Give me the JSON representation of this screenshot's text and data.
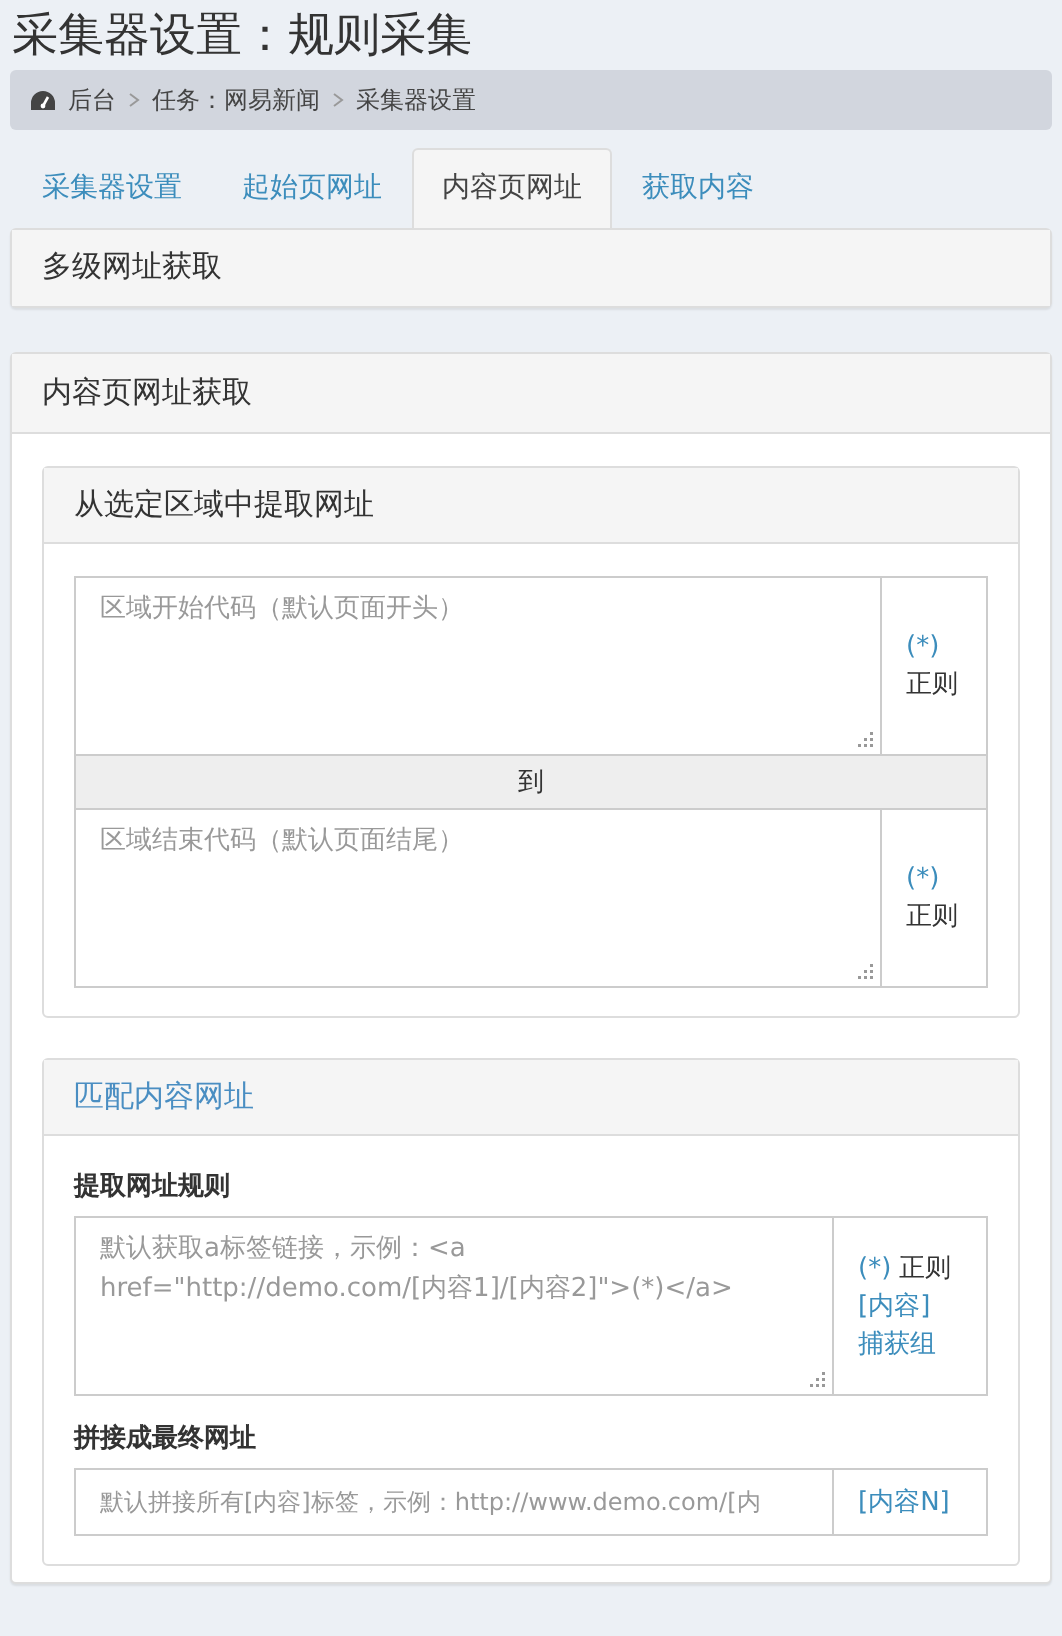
{
  "page_title": "采集器设置：规则采集",
  "breadcrumb": [
    "后台",
    "任务：网易新闻",
    "采集器设置"
  ],
  "tabs": [
    {
      "label": "采集器设置",
      "selected": false
    },
    {
      "label": "起始页网址",
      "selected": false
    },
    {
      "label": "内容页网址",
      "selected": true
    },
    {
      "label": "获取内容",
      "selected": false
    }
  ],
  "top_panel": {
    "title": "多级网址获取"
  },
  "main_panel": {
    "title": "内容页网址获取",
    "region_panel": {
      "title": "从选定区域中提取网址",
      "kind": "default",
      "start_field": {
        "placeholder": "区域开始代码（默认页面开头）",
        "addon": [
          {
            "kind": "link",
            "text": "(*)"
          },
          {
            "kind": "text",
            "text": "正则"
          }
        ]
      },
      "separator": "到",
      "end_field": {
        "placeholder": "区域结束代码（默认页面结尾）",
        "addon": [
          {
            "kind": "link",
            "text": "(*)"
          },
          {
            "kind": "text",
            "text": "正则"
          }
        ]
      }
    },
    "match_panel": {
      "title": "匹配内容网址",
      "kind": "info",
      "fields": [
        {
          "label": "提取网址规则",
          "kind": "textarea",
          "placeholder": "默认获取a标签链接，示例：<a href=\"http://demo.com/[内容1]/[内容2]\">(*)</a>",
          "addon": [
            {
              "kind": "link",
              "text": "(*)"
            },
            {
              "kind": "text",
              "text": "正则"
            },
            {
              "kind": "link",
              "text": "[内容]"
            },
            {
              "kind": "link",
              "text": "捕获组"
            }
          ]
        },
        {
          "label": "拼接成最终网址",
          "kind": "input",
          "placeholder": "默认拼接所有[内容]标签，示例：http://www.demo.com/[内",
          "addon": [
            {
              "kind": "link",
              "text": "[内容N]"
            }
          ]
        }
      ]
    }
  }
}
